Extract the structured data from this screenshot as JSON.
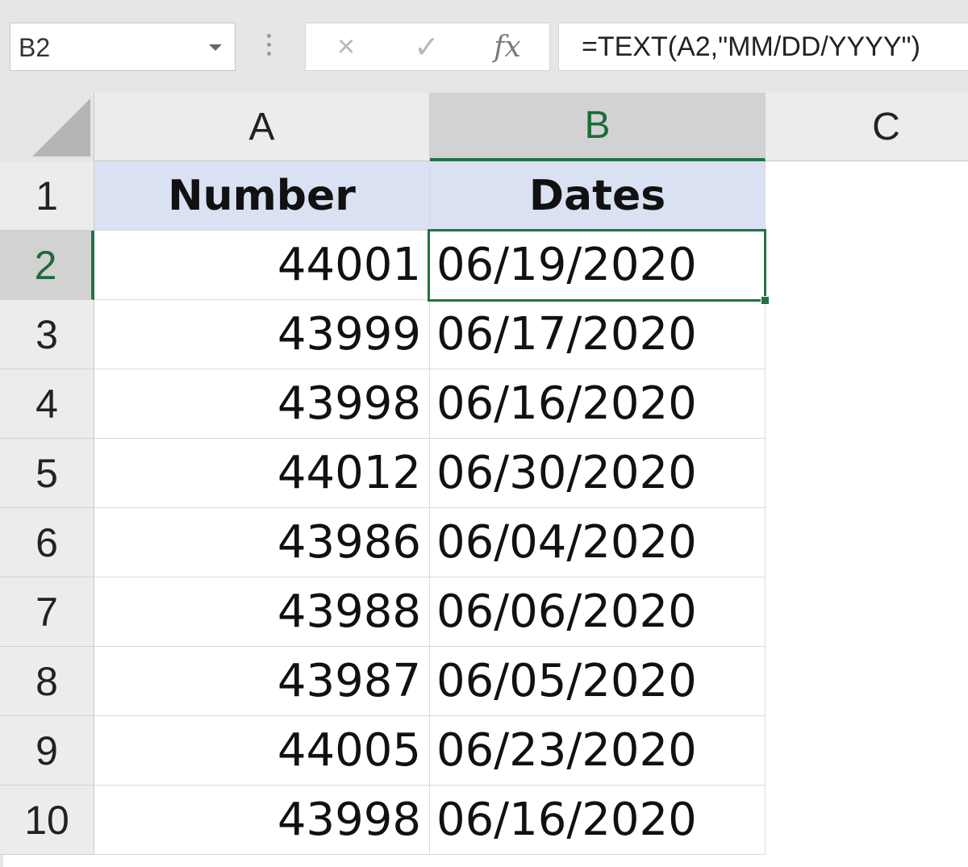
{
  "formula_bar": {
    "name_box": "B2",
    "cancel_icon": "×",
    "enter_icon": "✓",
    "fx_label": "fx",
    "formula": "=TEXT(A2,\"MM/DD/YYYY\")"
  },
  "columns": [
    "A",
    "B",
    "C"
  ],
  "active_cell": "B2",
  "rows": [
    {
      "row": "1",
      "a": "Number",
      "b": "Dates"
    },
    {
      "row": "2",
      "a": "44001",
      "b": "06/19/2020"
    },
    {
      "row": "3",
      "a": "43999",
      "b": "06/17/2020"
    },
    {
      "row": "4",
      "a": "43998",
      "b": "06/16/2020"
    },
    {
      "row": "5",
      "a": "44012",
      "b": "06/30/2020"
    },
    {
      "row": "6",
      "a": "43986",
      "b": "06/04/2020"
    },
    {
      "row": "7",
      "a": "43988",
      "b": "06/06/2020"
    },
    {
      "row": "8",
      "a": "43987",
      "b": "06/05/2020"
    },
    {
      "row": "9",
      "a": "44005",
      "b": "06/23/2020"
    },
    {
      "row": "10",
      "a": "43998",
      "b": "06/16/2020"
    }
  ],
  "colors": {
    "header_fill": "#d9e1f2",
    "selection_accent": "#217346"
  }
}
